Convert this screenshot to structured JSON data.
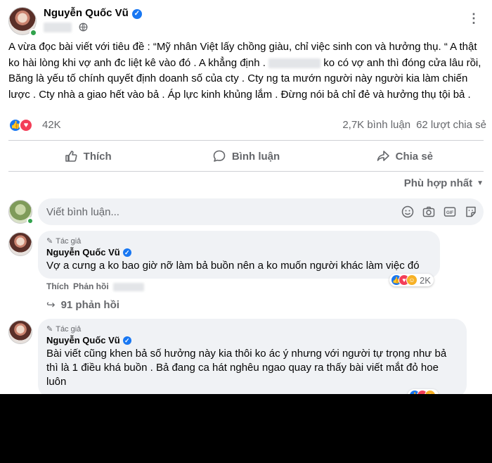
{
  "post": {
    "author": "Nguyễn Quốc Vũ",
    "body": "A vừa đọc bài viết với tiêu đề : “Mỹ nhân Việt lấy chồng giàu, chỉ việc sinh con và hưởng thụ. “ A thật ko hài lòng khi vợ anh đc liệt kê vào đó . A khẳng định . ",
    "body_after_blur": " ko có vợ anh thì đóng cửa lâu rồi, Băng là yếu tố chính quyết định doanh số của cty . Cty ng ta mướn người này người kia làm chiến lược . Cty nhà a giao hết vào bả . Áp lực kinh khủng lắm . Đừng nói bả chỉ đẻ và hưởng thụ tội bả .",
    "reactions_count": "42K",
    "comments_count": "2,7K bình luận",
    "shares_count": "62 lượt chia sẻ"
  },
  "actions": {
    "like": "Thích",
    "comment": "Bình luận",
    "share": "Chia sẻ"
  },
  "sort": {
    "label": "Phù hợp nhất"
  },
  "composer": {
    "placeholder": "Viết bình luận..."
  },
  "comments": [
    {
      "author_tag": "Tác giả",
      "author": "Nguyễn Quốc Vũ",
      "text": "Vợ a cưng a ko bao giờ nỡ làm bả buồn nên a ko muốn người khác làm việc đó",
      "like": "Thích",
      "reply": "Phản hồi",
      "reactions": "2K",
      "replies": "91 phản hồi"
    },
    {
      "author_tag": "Tác giả",
      "author": "Nguyễn Quốc Vũ",
      "text": "Bài viết cũng khen bả số hưởng này kia thôi ko ác ý nhưng với người tự trọng như bả thì là 1 điều khá buồn . Bả đang ca hát nghêu ngao quay ra thấy bài viết mắt đỏ hoe luôn"
    }
  ],
  "colors": {
    "brand_blue": "#1877f2",
    "secondary_text": "#65676b",
    "bubble_bg": "#f0f2f5",
    "online_green": "#31a24c"
  }
}
